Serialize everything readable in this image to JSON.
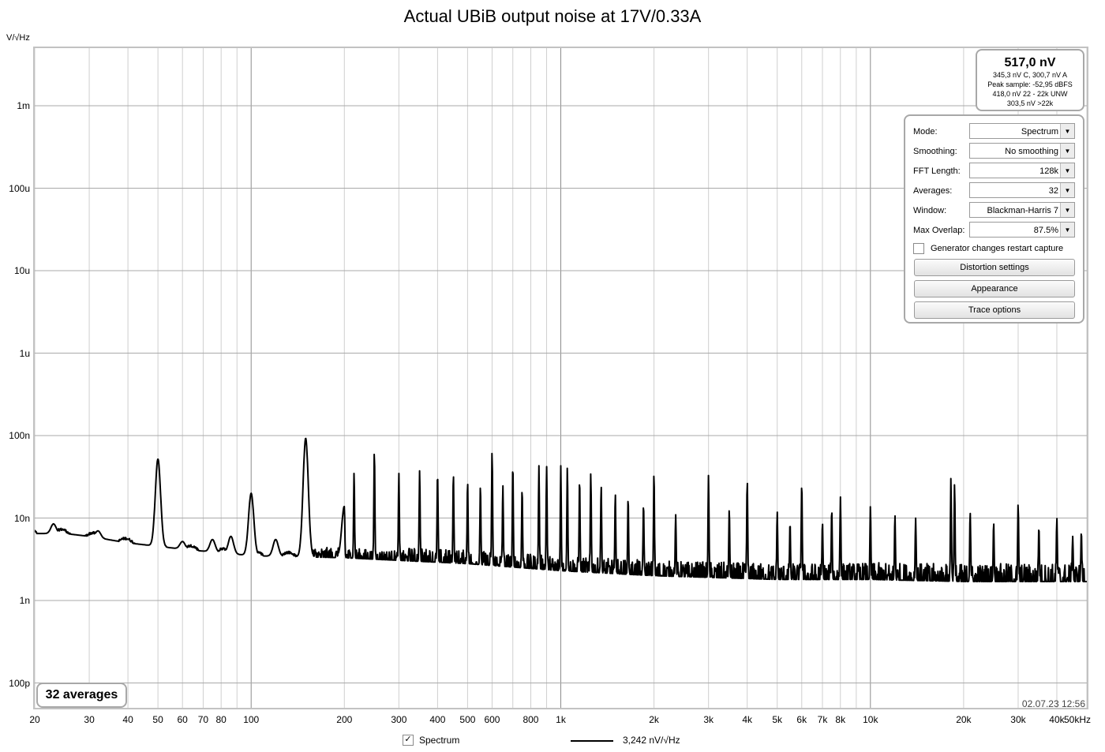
{
  "title": "Actual UBiB output noise at 17V/0.33A",
  "y_unit": "V/√Hz",
  "timestamp": "02.07.23 12:56",
  "averages_badge": "32 averages",
  "reading": {
    "main": "517,0 nV",
    "lines": [
      "345,3 nV C, 300,7 nV A",
      "Peak sample: -52,95 dBFS",
      "418,0 nV 22 - 22k UNW",
      "303,5 nV >22k"
    ]
  },
  "controls": {
    "mode": {
      "label": "Mode:",
      "value": "Spectrum"
    },
    "smoothing": {
      "label": "Smoothing:",
      "value": "No  smoothing"
    },
    "fft_length": {
      "label": "FFT Length:",
      "value": "128k"
    },
    "averages": {
      "label": "Averages:",
      "value": "32"
    },
    "window": {
      "label": "Window:",
      "value": "Blackman-Harris 7"
    },
    "max_overlap": {
      "label": "Max Overlap:",
      "value": "87.5%"
    },
    "restart_checkbox": {
      "label": "Generator changes restart capture",
      "checked": false
    },
    "buttons": [
      "Distortion settings",
      "Appearance",
      "Trace options"
    ]
  },
  "legend": {
    "name": "Spectrum",
    "checked": true,
    "level": "3,242 nV/√Hz"
  },
  "chart_data": {
    "type": "line",
    "title": "Actual UBiB output noise at 17V/0.33A",
    "xlabel": "",
    "ylabel": "V/√Hz",
    "x_scale": "log",
    "y_scale": "log",
    "xlim": [
      20,
      50000
    ],
    "ylim": [
      5e-11,
      0.005
    ],
    "grid": true,
    "x_major_ticks": [
      100,
      1000,
      10000
    ],
    "x_tick_labels": [
      {
        "v": 20,
        "t": "20"
      },
      {
        "v": 30,
        "t": "30"
      },
      {
        "v": 40,
        "t": "40"
      },
      {
        "v": 50,
        "t": "50"
      },
      {
        "v": 60,
        "t": "60"
      },
      {
        "v": 70,
        "t": "70"
      },
      {
        "v": 80,
        "t": "80"
      },
      {
        "v": 100,
        "t": "100"
      },
      {
        "v": 200,
        "t": "200"
      },
      {
        "v": 300,
        "t": "300"
      },
      {
        "v": 400,
        "t": "400"
      },
      {
        "v": 500,
        "t": "500"
      },
      {
        "v": 600,
        "t": "600"
      },
      {
        "v": 800,
        "t": "800"
      },
      {
        "v": 1000,
        "t": "1k"
      },
      {
        "v": 2000,
        "t": "2k"
      },
      {
        "v": 3000,
        "t": "3k"
      },
      {
        "v": 4000,
        "t": "4k"
      },
      {
        "v": 5000,
        "t": "5k"
      },
      {
        "v": 6000,
        "t": "6k"
      },
      {
        "v": 7000,
        "t": "7k"
      },
      {
        "v": 8000,
        "t": "8k"
      },
      {
        "v": 10000,
        "t": "10k"
      },
      {
        "v": 20000,
        "t": "20k"
      },
      {
        "v": 30000,
        "t": "30k"
      },
      {
        "v": 40000,
        "t": "40k"
      },
      {
        "v": 50000,
        "t": "50kHz"
      }
    ],
    "y_tick_labels": [
      {
        "v": 0.001,
        "t": "1m"
      },
      {
        "v": 0.0001,
        "t": "100u"
      },
      {
        "v": 1e-05,
        "t": "10u"
      },
      {
        "v": 1e-06,
        "t": "1u"
      },
      {
        "v": 1e-07,
        "t": "100n"
      },
      {
        "v": 1e-08,
        "t": "10n"
      },
      {
        "v": 1e-09,
        "t": "1n"
      },
      {
        "v": 1e-10,
        "t": "100p"
      }
    ],
    "series": [
      {
        "name": "Spectrum",
        "color": "#000000",
        "noise_floor": [
          [
            20,
            6.5e-09
          ],
          [
            25,
            6.5e-09
          ],
          [
            30,
            6e-09
          ],
          [
            40,
            5e-09
          ],
          [
            60,
            4.2e-09
          ],
          [
            100,
            3.5e-09
          ],
          [
            200,
            3.3e-09
          ],
          [
            500,
            2.8e-09
          ],
          [
            1000,
            2.3e-09
          ],
          [
            2000,
            2e-09
          ],
          [
            5000,
            1.8e-09
          ],
          [
            10000,
            1.8e-09
          ],
          [
            20000,
            1.7e-09
          ],
          [
            50000,
            1.7e-09
          ]
        ],
        "peaks": [
          [
            23,
            8.5e-09
          ],
          [
            32,
            7e-09
          ],
          [
            50,
            5.2e-08
          ],
          [
            60,
            5.2e-09
          ],
          [
            75,
            5.5e-09
          ],
          [
            86,
            6e-09
          ],
          [
            100,
            2e-08
          ],
          [
            120,
            5.5e-09
          ],
          [
            150,
            9.3e-08
          ],
          [
            200,
            1.4e-08
          ],
          [
            215,
            3.6e-08
          ],
          [
            250,
            6.6e-08
          ],
          [
            300,
            3.5e-08
          ],
          [
            350,
            3.8e-08
          ],
          [
            400,
            3.6e-08
          ],
          [
            450,
            3.5e-08
          ],
          [
            500,
            2.8e-08
          ],
          [
            550,
            2.5e-08
          ],
          [
            600,
            6.5e-08
          ],
          [
            650,
            2.5e-08
          ],
          [
            700,
            4.5e-08
          ],
          [
            750,
            2.3e-08
          ],
          [
            850,
            4.3e-08
          ],
          [
            900,
            4.2e-08
          ],
          [
            1000,
            4.3e-08
          ],
          [
            1050,
            4.2e-08
          ],
          [
            1150,
            3e-08
          ],
          [
            1250,
            3.5e-08
          ],
          [
            1350,
            2.5e-08
          ],
          [
            1500,
            2e-08
          ],
          [
            1650,
            1.8e-08
          ],
          [
            1850,
            1.5e-08
          ],
          [
            2000,
            3.6e-08
          ],
          [
            2350,
            1.1e-08
          ],
          [
            3000,
            3.3e-08
          ],
          [
            3500,
            1.3e-08
          ],
          [
            4000,
            2.9e-08
          ],
          [
            5000,
            1.2e-08
          ],
          [
            5500,
            9e-09
          ],
          [
            6000,
            2.7e-08
          ],
          [
            7000,
            9e-09
          ],
          [
            7500,
            1.3e-08
          ],
          [
            8000,
            1.8e-08
          ],
          [
            10000,
            1.4e-08
          ],
          [
            12000,
            1.1e-08
          ],
          [
            14000,
            1e-08
          ],
          [
            18200,
            3.1e-08
          ],
          [
            18700,
            2.6e-08
          ],
          [
            21000,
            1.2e-08
          ],
          [
            25000,
            9e-09
          ],
          [
            30000,
            1.5e-08
          ],
          [
            35000,
            8e-09
          ],
          [
            40000,
            1e-08
          ],
          [
            45000,
            6e-09
          ],
          [
            48000,
            7e-09
          ]
        ]
      }
    ]
  }
}
